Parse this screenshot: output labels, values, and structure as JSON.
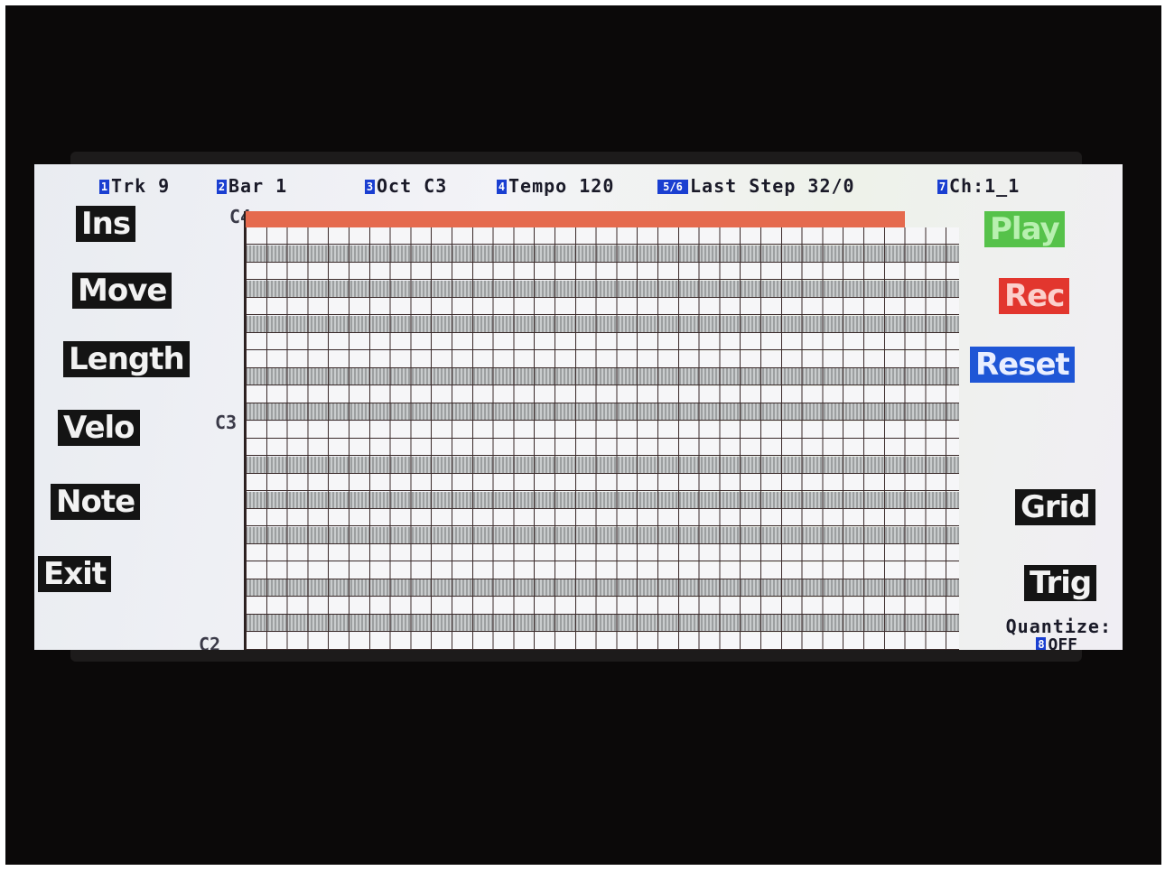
{
  "header": {
    "items": [
      {
        "num": "1",
        "label": "Trk 9"
      },
      {
        "num": "2",
        "label": "Bar 1"
      },
      {
        "num": "3",
        "label": "Oct C3"
      },
      {
        "num": "4",
        "label": "Tempo 120"
      },
      {
        "num": "5/6",
        "label": "Last Step 32/0"
      },
      {
        "num": "7",
        "label": "Ch:1_1"
      }
    ]
  },
  "left_buttons": [
    "Ins",
    "Move",
    "Length",
    "Velo",
    "Note",
    "Exit"
  ],
  "right_buttons": [
    "Play",
    "Rec",
    "Reset",
    "Grid",
    "Trig"
  ],
  "note_labels": [
    "C4",
    "C3",
    "C2"
  ],
  "quantize": {
    "label": "Quantize:",
    "num": "8",
    "value": "OFF"
  },
  "colors": {
    "play": "#56c24a",
    "rec": "#e2362e",
    "reset": "#1f56d6",
    "active_row": "#e56a4e",
    "number_badge": "#1a3fd1"
  }
}
